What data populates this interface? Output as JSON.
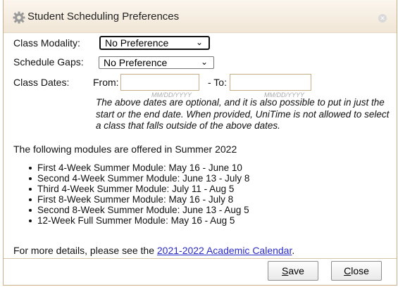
{
  "dialog": {
    "title": "Student Scheduling Preferences",
    "title_icon": "gear-icon",
    "close_icon": "close-icon"
  },
  "modality": {
    "label": "Class Modality:",
    "value": "No Preference"
  },
  "gaps": {
    "label": "Schedule Gaps:",
    "value": "No Preference"
  },
  "dates": {
    "label": "Class Dates:",
    "from_label": "From:",
    "to_label": "- To:",
    "from_value": "",
    "to_value": "",
    "from_hint": "MM/DD/YYYY",
    "to_hint": "MM/DD/YYYY",
    "note": "The above dates are optional, and it is also possible to put in just the start or the end date. When provided, UniTime is not allowed to select a class that falls outside of the above dates."
  },
  "modules": {
    "intro": "The following modules are offered in Summer 2022",
    "items": [
      "First 4-Week Summer Module: May 16 - June 10",
      "Second 4-Week Summer Module: June 13 - July 8",
      "Third 4-Week Summer Module: July 11 - Aug 5",
      "First 8-Week Summer Module: May 16 - July 8",
      "Second 8-Week Summer Module: June 13 - Aug 5",
      "12-Week Full Summer Module: May 16 - Aug 5"
    ]
  },
  "details": {
    "prefix": "For more details, please see the ",
    "link": "2021-2022 Academic Calendar",
    "suffix": "."
  },
  "buttons": {
    "save_key": "S",
    "save_rest": "ave",
    "close_key": "C",
    "close_rest": "lose"
  },
  "colors": {
    "title_bar": "#f1e6d6",
    "border": "#c9ad86",
    "link": "#2a2ac8"
  }
}
